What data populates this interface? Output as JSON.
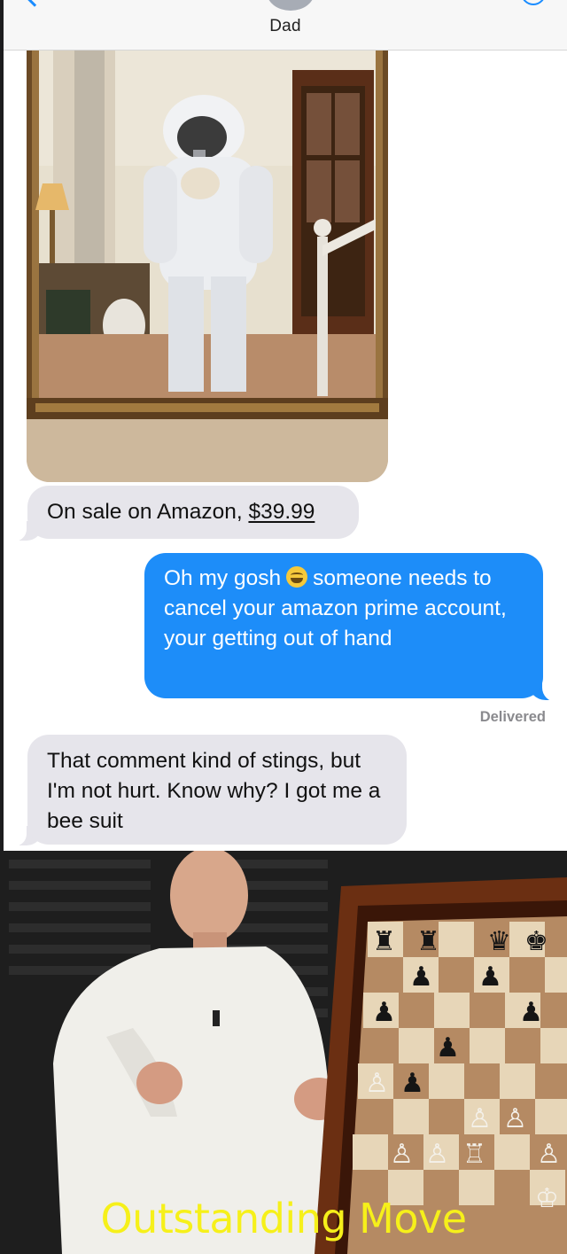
{
  "conversation": {
    "contact_name": "Dad",
    "messages": [
      {
        "id": "msg-1",
        "direction": "incoming",
        "text_before": "On sale on Amazon, ",
        "price": "$39.99"
      },
      {
        "id": "msg-2",
        "direction": "outgoing",
        "text_part1": "Oh my gosh",
        "emoji": "grinning-sweat-emoji",
        "text_part2": "someone needs to cancel your amazon prime account, your getting out of hand"
      },
      {
        "id": "msg-3",
        "direction": "incoming",
        "text": "That comment kind of stings, but I'm not hurt. Know why? I got me a bee suit"
      }
    ],
    "status": "Delivered"
  },
  "meme": {
    "caption": "Outstanding Move"
  },
  "colors": {
    "outgoing_bubble": "#1d8df9",
    "incoming_bubble": "#e6e5eb",
    "caption": "#f6f01a",
    "delivered_text": "#8a8a8e"
  },
  "icons": [
    "back-chevron-icon",
    "contact-avatar",
    "info-icon",
    "grinning-sweat-emoji",
    "white-king-icon",
    "black-king-icon",
    "black-rook-icon",
    "black-queen-icon",
    "black-pawn-icon",
    "white-pawn-icon"
  ]
}
